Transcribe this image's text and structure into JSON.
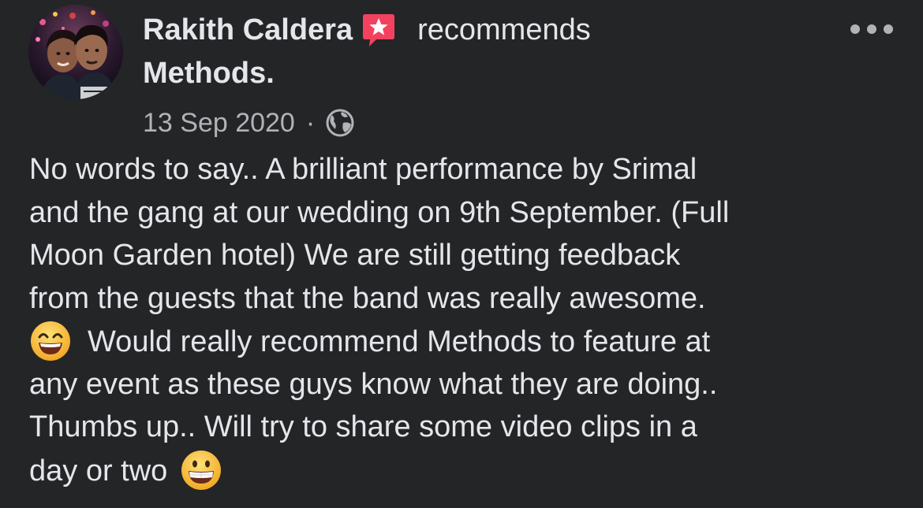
{
  "post": {
    "author": "Rakith Caldera",
    "action": "recommends",
    "page": "Methods.",
    "date": "13 Sep 2020",
    "separator": "·",
    "audience_icon": "globe-icon",
    "more_icon": "more-options-icon",
    "badge_icon": "recommendation-star-icon",
    "body_lines": {
      "l1": "No words to say.. A brilliant performance by Srimal",
      "l2": "and the gang at our wedding on 9th September. (Full",
      "l3": "Moon Garden hotel) We are still getting feedback",
      "l4": "from the guests that the band was really awesome.",
      "l5": "Would really recommend Methods to feature at",
      "l6": "any event as these guys know what they are doing..",
      "l7": "Thumbs up.. Will try to share some video clips in a",
      "l8": "day or two"
    },
    "emojis": [
      "smiling-face-emoji",
      "grinning-face-emoji"
    ]
  },
  "colors": {
    "background": "#242526",
    "primary_text": "#e4e6eb",
    "secondary_text": "#b0b3b8",
    "badge": "#f3425f"
  }
}
